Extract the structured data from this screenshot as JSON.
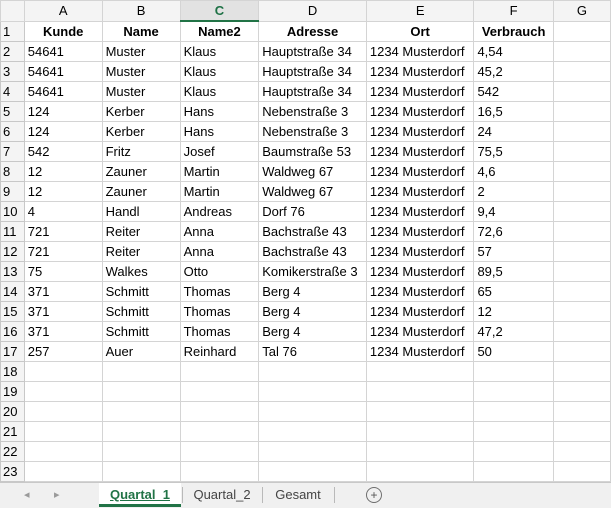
{
  "columns": [
    "A",
    "B",
    "C",
    "D",
    "E",
    "F",
    "G"
  ],
  "selected_column": "C",
  "headers": [
    "Kunde",
    "Name",
    "Name2",
    "Adresse",
    "Ort",
    "Verbrauch",
    ""
  ],
  "rows": [
    [
      "54641",
      "Muster",
      "Klaus",
      "Hauptstraße 34",
      "1234 Musterdorf",
      "4,54"
    ],
    [
      "54641",
      "Muster",
      "Klaus",
      "Hauptstraße 34",
      "1234 Musterdorf",
      "45,2"
    ],
    [
      "54641",
      "Muster",
      "Klaus",
      "Hauptstraße 34",
      "1234 Musterdorf",
      "542"
    ],
    [
      "124",
      "Kerber",
      "Hans",
      "Nebenstraße 3",
      "1234 Musterdorf",
      "16,5"
    ],
    [
      "124",
      "Kerber",
      "Hans",
      "Nebenstraße 3",
      "1234 Musterdorf",
      "24"
    ],
    [
      "542",
      "Fritz",
      "Josef",
      "Baumstraße 53",
      "1234 Musterdorf",
      "75,5"
    ],
    [
      "12",
      "Zauner",
      "Martin",
      "Waldweg 67",
      "1234 Musterdorf",
      "4,6"
    ],
    [
      "12",
      "Zauner",
      "Martin",
      "Waldweg 67",
      "1234 Musterdorf",
      "2"
    ],
    [
      "4",
      "Handl",
      "Andreas",
      "Dorf 76",
      "1234 Musterdorf",
      "9,4"
    ],
    [
      "721",
      "Reiter",
      "Anna",
      "Bachstraße 43",
      "1234 Musterdorf",
      "72,6"
    ],
    [
      "721",
      "Reiter",
      "Anna",
      "Bachstraße 43",
      "1234 Musterdorf",
      "57"
    ],
    [
      "75",
      "Walkes",
      "Otto",
      "Komikerstraße 3",
      "1234 Musterdorf",
      "89,5"
    ],
    [
      "371",
      "Schmitt",
      "Thomas",
      "Berg 4",
      "1234 Musterdorf",
      "65"
    ],
    [
      "371",
      "Schmitt",
      "Thomas",
      "Berg 4",
      "1234 Musterdorf",
      "12"
    ],
    [
      "371",
      "Schmitt",
      "Thomas",
      "Berg 4",
      "1234 Musterdorf",
      "47,2"
    ],
    [
      "257",
      "Auer",
      "Reinhard",
      "Tal 76",
      "1234 Musterdorf",
      "50"
    ]
  ],
  "row_numbers": [
    "1",
    "2",
    "3",
    "4",
    "5",
    "6",
    "7",
    "8",
    "9",
    "10",
    "11",
    "12",
    "13",
    "14",
    "15",
    "16",
    "17",
    "18",
    "19",
    "20",
    "21",
    "22",
    "23"
  ],
  "tabs": [
    "Quartal_1",
    "Quartal_2",
    "Gesamt"
  ],
  "active_tab": "Quartal_1",
  "nav": {
    "prev_icon": "◂",
    "next_icon": "▸",
    "add_icon": "+"
  },
  "colors": {
    "accent": "#217346"
  }
}
